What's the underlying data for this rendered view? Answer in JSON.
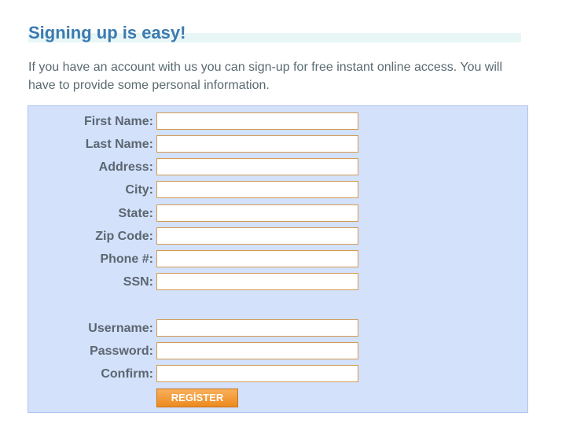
{
  "header": {
    "title": "Signing up is easy!",
    "intro": "If you have an account with us you can sign-up for free instant online access. You will have to provide some personal information."
  },
  "form": {
    "fields": [
      {
        "label": "First Name:",
        "value": ""
      },
      {
        "label": "Last Name:",
        "value": ""
      },
      {
        "label": "Address:",
        "value": ""
      },
      {
        "label": "City:",
        "value": ""
      },
      {
        "label": "State:",
        "value": ""
      },
      {
        "label": "Zip Code:",
        "value": ""
      },
      {
        "label": "Phone #:",
        "value": ""
      },
      {
        "label": "SSN:",
        "value": ""
      }
    ],
    "account_fields": [
      {
        "label": "Username:",
        "value": ""
      },
      {
        "label": "Password:",
        "value": ""
      },
      {
        "label": "Confirm:",
        "value": ""
      }
    ],
    "register_label": "REGİSTER"
  },
  "colors": {
    "title": "#3a7ab0",
    "panel_background": "#d3e1fb",
    "input_border": "#d39a52",
    "button": "#ec8a1f"
  }
}
